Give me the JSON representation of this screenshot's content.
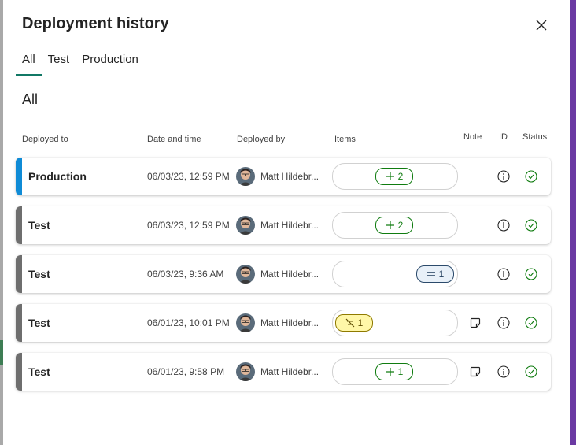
{
  "panel": {
    "title": "Deployment history",
    "tabs": [
      {
        "label": "All",
        "active": true
      },
      {
        "label": "Test",
        "active": false
      },
      {
        "label": "Production",
        "active": false
      }
    ],
    "section_title": "All"
  },
  "columns": {
    "deployed_to": "Deployed to",
    "date_time": "Date and time",
    "deployed_by": "Deployed by",
    "items": "Items",
    "note": "Note",
    "id": "ID",
    "status": "Status"
  },
  "colors": {
    "production_accent": "#0f8bd6",
    "test_accent": "#6e6e6e",
    "tab_underline": "#117865",
    "success": "#107c10",
    "side_accent": "#6b3aa3"
  },
  "rows": [
    {
      "stage": "Production",
      "datetime": "06/03/23, 12:59 PM",
      "deployed_by": "Matt Hildebr...",
      "items_badge": {
        "type": "added",
        "icon": "plus-icon",
        "count": "2"
      },
      "has_note": false,
      "status": "success"
    },
    {
      "stage": "Test",
      "datetime": "06/03/23, 12:59 PM",
      "deployed_by": "Matt Hildebr...",
      "items_badge": {
        "type": "added",
        "icon": "plus-icon",
        "count": "2"
      },
      "has_note": false,
      "status": "success"
    },
    {
      "stage": "Test",
      "datetime": "06/03/23, 9:36 AM",
      "deployed_by": "Matt Hildebr...",
      "items_badge": {
        "type": "unchanged",
        "icon": "equals-icon",
        "count": "1"
      },
      "has_note": false,
      "status": "success"
    },
    {
      "stage": "Test",
      "datetime": "06/01/23, 10:01 PM",
      "deployed_by": "Matt Hildebr...",
      "items_badge": {
        "type": "removed",
        "icon": "strikethrough-icon",
        "count": "1"
      },
      "has_note": true,
      "status": "success"
    },
    {
      "stage": "Test",
      "datetime": "06/01/23, 9:58 PM",
      "deployed_by": "Matt Hildebr...",
      "items_badge": {
        "type": "added",
        "icon": "plus-icon",
        "count": "1"
      },
      "has_note": true,
      "status": "success"
    }
  ]
}
